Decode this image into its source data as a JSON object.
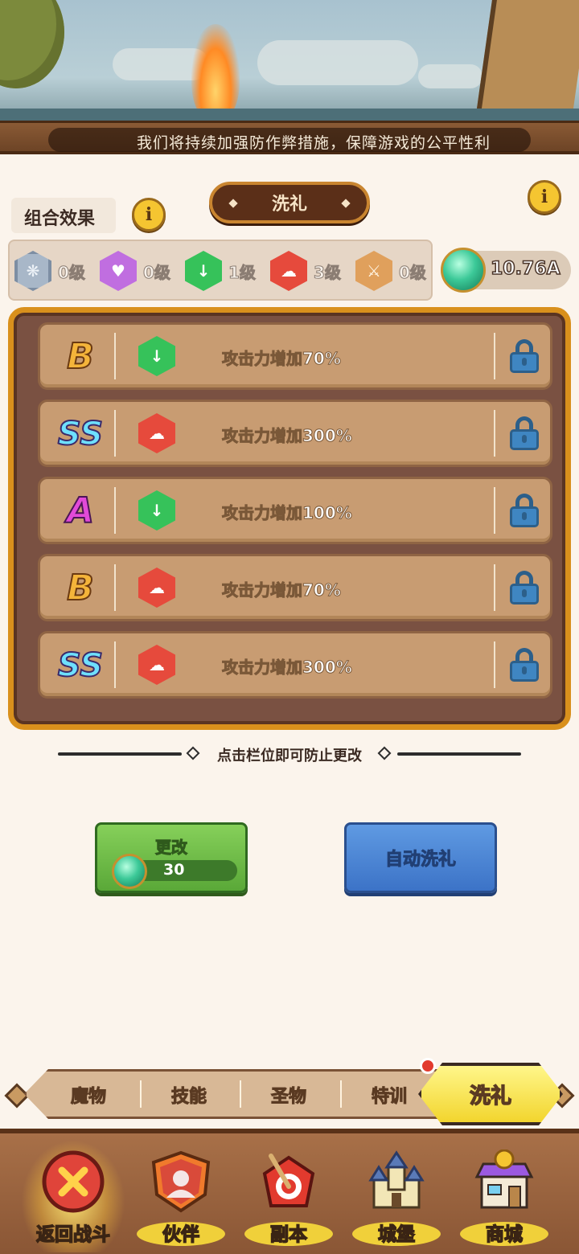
{
  "news": {
    "text": "我们将持续加强防作弊措施，保障游戏的公平性利"
  },
  "header": {
    "combo_title": "组合效果",
    "tab_label": "洗礼",
    "info_icon_glyph": "i"
  },
  "element_levels": [
    {
      "icon": "wing-icon",
      "color": "#a8b7c8",
      "glyph": "❋",
      "level": "0级"
    },
    {
      "icon": "heart-icon",
      "color": "#c06ee0",
      "glyph": "♥",
      "level": "0级"
    },
    {
      "icon": "sword-icon",
      "color": "#36c25a",
      "glyph": "↓",
      "level": "1级"
    },
    {
      "icon": "fist-icon",
      "color": "#e64a3c",
      "glyph": "☁",
      "level": "3级"
    },
    {
      "icon": "blade-icon",
      "color": "#e0a05c",
      "glyph": "⚔",
      "level": "0级"
    }
  ],
  "currency": {
    "icon": "green-gem-icon",
    "value": "10.76A"
  },
  "rows": [
    {
      "grade": "B",
      "element": "sword-icon",
      "effect": "攻击力增加70%",
      "locked": false
    },
    {
      "grade": "SS",
      "element": "fist-icon",
      "effect": "攻击力增加300%",
      "locked": false
    },
    {
      "grade": "A",
      "element": "sword-icon",
      "effect": "攻击力增加100%",
      "locked": false
    },
    {
      "grade": "B",
      "element": "fist-icon",
      "effect": "攻击力增加70%",
      "locked": false
    },
    {
      "grade": "SS",
      "element": "fist-icon",
      "effect": "攻击力增加300%",
      "locked": false
    }
  ],
  "hint": "点击栏位即可防止更改",
  "buttons": {
    "change_label": "更改",
    "change_cost": "30",
    "auto_label": "自动洗礼"
  },
  "subtabs": [
    "魔物",
    "技能",
    "圣物",
    "特训"
  ],
  "subtab_active": "洗礼",
  "nav": [
    {
      "label": "返回战斗",
      "icon": "close-x-icon",
      "selected": true
    },
    {
      "label": "伙伴",
      "icon": "partner-shield-icon",
      "selected": false
    },
    {
      "label": "副本",
      "icon": "target-arrow-icon",
      "selected": false
    },
    {
      "label": "城堡",
      "icon": "castle-icon",
      "selected": false
    },
    {
      "label": "商城",
      "icon": "shop-icon",
      "selected": false
    }
  ]
}
